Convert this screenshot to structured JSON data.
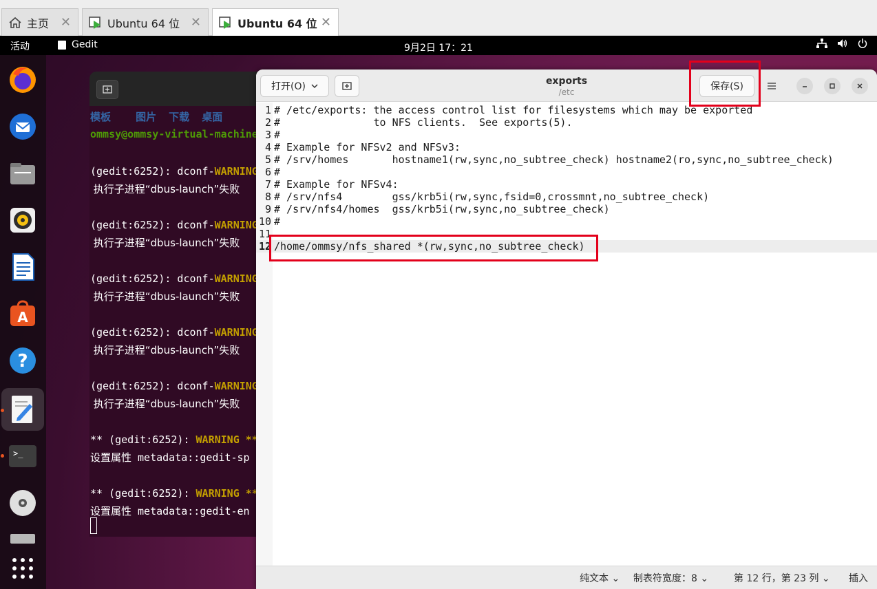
{
  "vm_tabs": [
    {
      "label": "主页",
      "icon": "home-icon"
    },
    {
      "label": "Ubuntu 64 位",
      "icon": "vm-icon"
    },
    {
      "label": "Ubuntu 64 位",
      "icon": "vm-icon"
    }
  ],
  "topbar": {
    "activities": "活动",
    "app_name": "Gedit",
    "clock": "9月2日  17：21"
  },
  "dock": {
    "items": [
      "firefox-icon",
      "thunderbird-icon",
      "files-icon",
      "rhythmbox-icon",
      "libreoffice-writer-icon",
      "app-center-icon",
      "help-icon",
      "gedit-icon",
      "terminal-icon",
      "dvd-icon",
      "trash-icon",
      "apps-grid-icon"
    ]
  },
  "terminal": {
    "dirs": "模板    图片  下载  桌面",
    "prompt": "ommsy@ommsy-virtual-machine",
    "warn_prefix": "(gedit:6252): dconf-",
    "warn_word": "WARNING",
    "error_line": " 执行子进程“dbus-launch”失败",
    "warning2_prefix": "** (gedit:6252): ",
    "warning2_word": "WARNING **",
    "meta_line_1": "设置属性 metadata::gedit-sp",
    "meta_line_2": "设置属性 metadata::gedit-en"
  },
  "gedit": {
    "open_label": "打开(O)",
    "title": "exports",
    "subtitle": "/etc",
    "save_label": "保存(S)",
    "lines": [
      {
        "n": "1",
        "t": "# /etc/exports: the access control list for filesystems which may be exported"
      },
      {
        "n": "2",
        "t": "#               to NFS clients.  See exports(5)."
      },
      {
        "n": "3",
        "t": "#"
      },
      {
        "n": "4",
        "t": "# Example for NFSv2 and NFSv3:"
      },
      {
        "n": "5",
        "t": "# /srv/homes       hostname1(rw,sync,no_subtree_check) hostname2(ro,sync,no_subtree_check)"
      },
      {
        "n": "6",
        "t": "#"
      },
      {
        "n": "7",
        "t": "# Example for NFSv4:"
      },
      {
        "n": "8",
        "t": "# /srv/nfs4        gss/krb5i(rw,sync,fsid=0,crossmnt,no_subtree_check)"
      },
      {
        "n": "9",
        "t": "# /srv/nfs4/homes  gss/krb5i(rw,sync,no_subtree_check)"
      },
      {
        "n": "10",
        "t": "#"
      },
      {
        "n": "11",
        "t": ""
      },
      {
        "n": "12",
        "t": "/home/ommsy/nfs_shared *(rw,sync,no_subtree_check)"
      }
    ],
    "status": {
      "syntax": "纯文本",
      "tab_width": "制表符宽度：8",
      "position": "第 12 行，第 23 列",
      "mode": "插入"
    }
  },
  "colors": {
    "highlight": "#e3001b",
    "accent": "#e95420"
  }
}
